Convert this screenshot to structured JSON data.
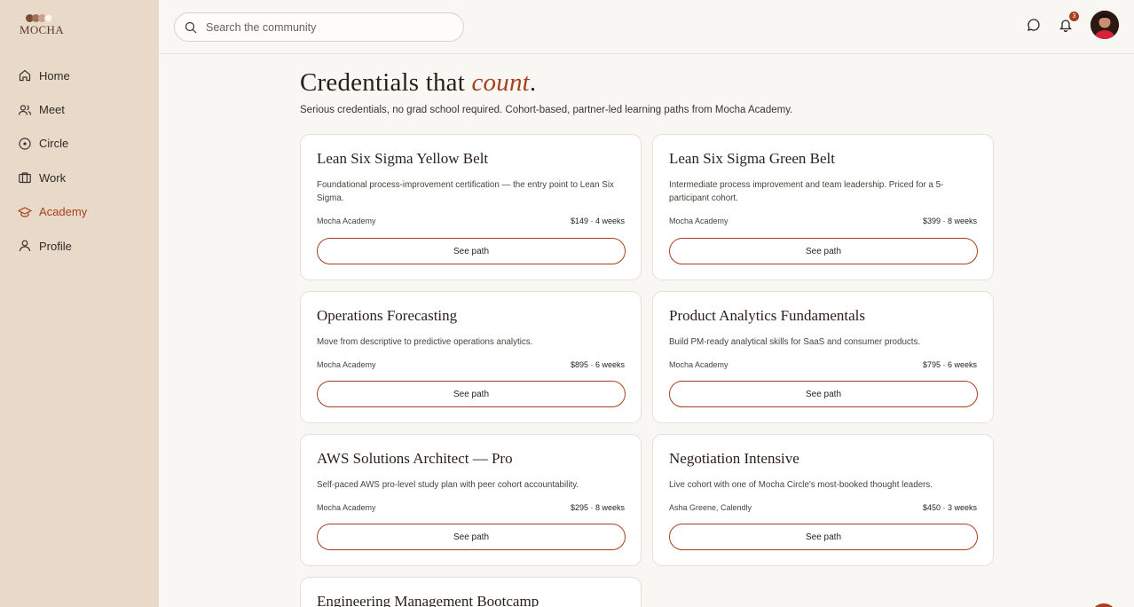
{
  "app": {
    "logo_text": "MOCHA",
    "accent": "#a4401e"
  },
  "sidebar": {
    "items": [
      {
        "label": "Home",
        "icon": "home-icon"
      },
      {
        "label": "Meet",
        "icon": "users-icon"
      },
      {
        "label": "Circle",
        "icon": "circle-dot-icon"
      },
      {
        "label": "Work",
        "icon": "briefcase-icon"
      },
      {
        "label": "Academy",
        "icon": "graduation-cap-icon",
        "active": true
      },
      {
        "label": "Profile",
        "icon": "user-icon"
      }
    ]
  },
  "header": {
    "search_placeholder": "Search the community",
    "notification_count": "3"
  },
  "page": {
    "title_main": "Credentials that ",
    "title_accent": "count",
    "title_end": ".",
    "subtitle": "Serious credentials, no grad school required. Cohort-based, partner-led learning paths from Mocha Academy."
  },
  "courses": [
    {
      "title": "Lean Six Sigma Yellow Belt",
      "description": "Foundational process-improvement certification — the entry point to Lean Six Sigma.",
      "provider": "Mocha Academy",
      "price_duration": "$149 · 4 weeks",
      "button": "See path"
    },
    {
      "title": "Lean Six Sigma Green Belt",
      "description": "Intermediate process improvement and team leadership. Priced for a 5-participant cohort.",
      "provider": "Mocha Academy",
      "price_duration": "$399 · 8 weeks",
      "button": "See path"
    },
    {
      "title": "Operations Forecasting",
      "description": "Move from descriptive to predictive operations analytics.",
      "provider": "Mocha Academy",
      "price_duration": "$895 · 6 weeks",
      "button": "See path"
    },
    {
      "title": "Product Analytics Fundamentals",
      "description": "Build PM-ready analytical skills for SaaS and consumer products.",
      "provider": "Mocha Academy",
      "price_duration": "$795 · 6 weeks",
      "button": "See path"
    },
    {
      "title": "AWS Solutions Architect — Pro",
      "description": "Self-paced AWS pro-level study plan with peer cohort accountability.",
      "provider": "Mocha Academy",
      "price_duration": "$295 · 8 weeks",
      "button": "See path"
    },
    {
      "title": "Negotiation Intensive",
      "description": "Live cohort with one of Mocha Circle's most-booked thought leaders.",
      "provider": "Asha Greene, Calendly",
      "price_duration": "$450 · 3 weeks",
      "button": "See path"
    },
    {
      "title": "Engineering Management Bootcamp"
    }
  ]
}
